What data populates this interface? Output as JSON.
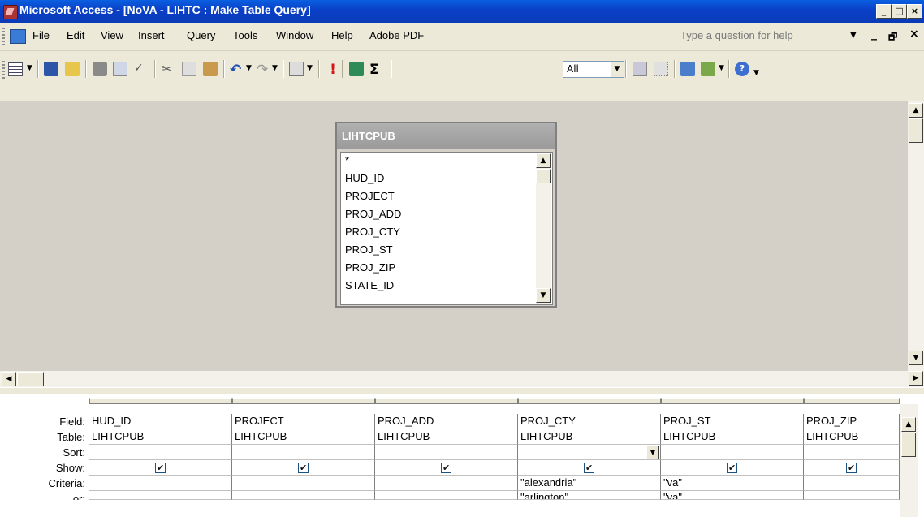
{
  "window": {
    "title": "Microsoft Access - [NoVA - LIHTC : Make Table Query]",
    "minimize": "_",
    "maximize": "□",
    "close": "×"
  },
  "menu": {
    "items": [
      "File",
      "Edit",
      "View",
      "Insert",
      "Query",
      "Tools",
      "Window",
      "Help",
      "Adobe PDF"
    ],
    "help_placeholder": "Type a question for help",
    "mdi_min": "_",
    "mdi_restore": "🗗",
    "mdi_close": "×"
  },
  "toolbar": {
    "top_values": "All",
    "sigma": "Σ"
  },
  "field_list": {
    "title": "LIHTCPUB",
    "fields": [
      "*",
      "HUD_ID",
      "PROJECT",
      "PROJ_ADD",
      "PROJ_CTY",
      "PROJ_ST",
      "PROJ_ZIP",
      "STATE_ID"
    ]
  },
  "grid": {
    "row_labels": [
      "Field:",
      "Table:",
      "Sort:",
      "Show:",
      "Criteria:",
      "or:"
    ],
    "columns": [
      {
        "field": "HUD_ID",
        "table": "LIHTCPUB",
        "sort": "",
        "show": true,
        "criteria": "",
        "or": ""
      },
      {
        "field": "PROJECT",
        "table": "LIHTCPUB",
        "sort": "",
        "show": true,
        "criteria": "",
        "or": ""
      },
      {
        "field": "PROJ_ADD",
        "table": "LIHTCPUB",
        "sort": "",
        "show": true,
        "criteria": "",
        "or": ""
      },
      {
        "field": "PROJ_CTY",
        "table": "LIHTCPUB",
        "sort": "",
        "show": true,
        "criteria": "\"alexandria\"",
        "or": "\"arlington\""
      },
      {
        "field": "PROJ_ST",
        "table": "LIHTCPUB",
        "sort": "",
        "show": true,
        "criteria": "\"va\"",
        "or": "\"va\""
      },
      {
        "field": "PROJ_ZIP",
        "table": "LIHTCPUB",
        "sort": "",
        "show": true,
        "criteria": "",
        "or": ""
      }
    ]
  },
  "colors": {
    "titlebar": "#0a3fc7",
    "face": "#ece9d8",
    "design_bg": "#d4d0c8"
  }
}
